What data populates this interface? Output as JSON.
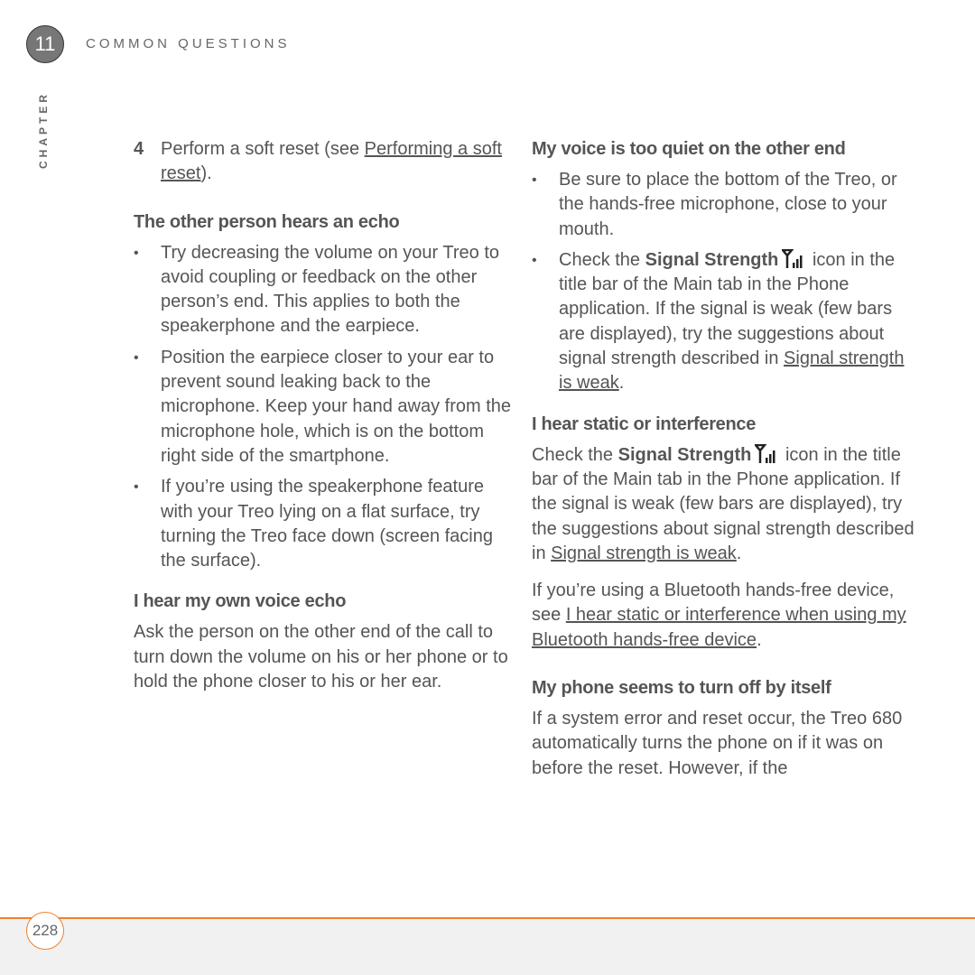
{
  "header": {
    "chapter_number": "11",
    "chapter_title": "COMMON QUESTIONS",
    "chapter_label": "CHAPTER"
  },
  "left": {
    "step": {
      "number": "4",
      "text_before": "Perform a soft reset (see ",
      "link": "Performing a soft reset",
      "text_after": ")."
    },
    "section1": {
      "heading": "The other person hears an echo",
      "bullets": [
        "Try decreasing the volume on your Treo to avoid coupling or feedback on the other person’s end. This applies to both the speakerphone and the earpiece.",
        "Position the earpiece closer to your ear to prevent sound leaking back to the microphone. Keep your hand away from the microphone hole, which is on the bottom right side of the smartphone.",
        "If you’re using the speakerphone feature with your Treo lying on a flat surface, try turning the Treo face down (screen facing the surface)."
      ]
    },
    "section2": {
      "heading": "I hear my own voice echo",
      "body": "Ask the person on the other end of the call to turn down the volume on his or her phone or to hold the phone closer to his or her ear."
    }
  },
  "right": {
    "section1": {
      "heading": "My voice is too quiet on the other end",
      "bullet1": "Be sure to place the bottom of the Treo, or the hands-free microphone, close to your mouth.",
      "bullet2_pre": "Check the ",
      "bullet2_bold": "Signal Strength",
      "bullet2_mid": " icon in the title bar of the Main tab in the Phone application. If the signal is weak (few bars are displayed), try the suggestions about signal strength described in ",
      "bullet2_link": "Signal strength is weak",
      "bullet2_end": "."
    },
    "section2": {
      "heading": "I hear static or interference",
      "p1_pre": "Check the ",
      "p1_bold": "Signal Strength",
      "p1_mid": " icon in the title bar of the Main tab in the Phone application. If the signal is weak (few bars are displayed), try the suggestions about signal strength described in ",
      "p1_link": "Signal strength is weak",
      "p1_end": ".",
      "p2_pre": "If you’re using a Bluetooth hands-free device, see ",
      "p2_link": "I hear static or interference when using my Bluetooth hands-free device",
      "p2_end": "."
    },
    "section3": {
      "heading": "My phone seems to turn off by itself",
      "body": "If a system error and reset occur, the Treo 680 automatically turns the phone on if it was on before the reset. However, if the"
    }
  },
  "footer": {
    "page_number": "228",
    "accent_color": "#f08030"
  }
}
